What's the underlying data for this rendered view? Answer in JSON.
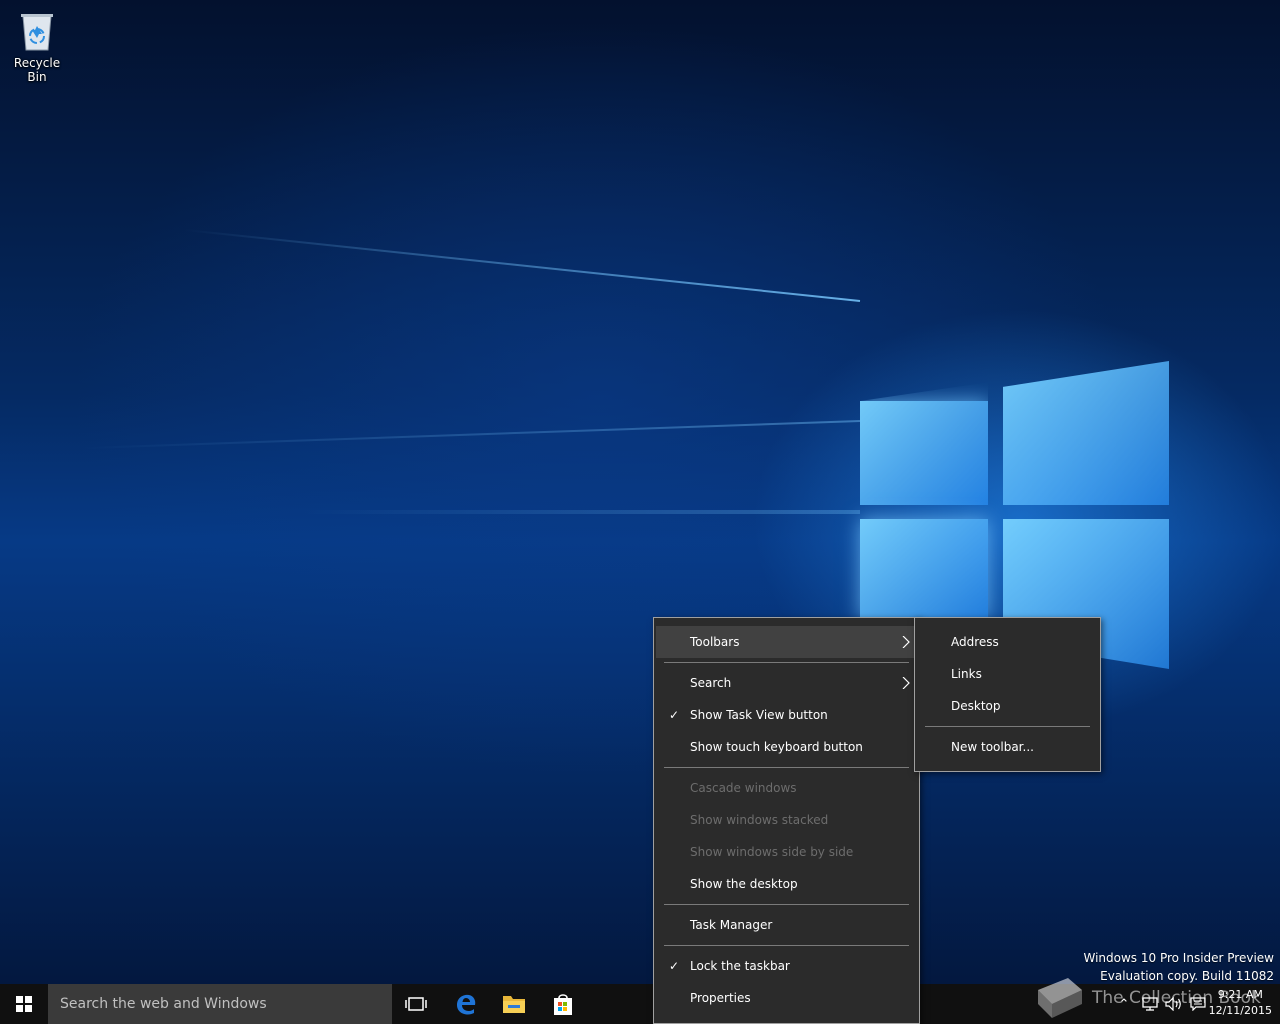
{
  "desktop": {
    "icons": [
      {
        "label": "Recycle Bin",
        "icon": "recycle-bin-icon"
      }
    ]
  },
  "watermark": {
    "line1": "Windows 10 Pro Insider Preview",
    "line2": "Evaluation copy. Build 11082",
    "brand": "The Collection Book"
  },
  "taskbar": {
    "search_placeholder": "Search the web and Windows",
    "pinned": [
      "start-icon",
      "task-view-icon",
      "edge-icon",
      "file-explorer-icon",
      "store-icon"
    ],
    "clock_time": "9:21 AM",
    "clock_date": "12/11/2015"
  },
  "context_menu": {
    "toolbars": "Toolbars",
    "search": "Search",
    "show_task_view": "Show Task View button",
    "show_touch_keyboard": "Show touch keyboard button",
    "cascade": "Cascade windows",
    "stacked": "Show windows stacked",
    "side_by_side": "Show windows side by side",
    "show_desktop": "Show the desktop",
    "task_manager": "Task Manager",
    "lock_taskbar": "Lock the taskbar",
    "properties": "Properties",
    "check_glyph": "✓"
  },
  "toolbars_submenu": {
    "address": "Address",
    "links": "Links",
    "desktop": "Desktop",
    "new_toolbar": "New toolbar..."
  },
  "colors": {
    "taskbar": "#101010",
    "menu_bg": "#2b2b2b",
    "menu_highlight": "#414141",
    "disabled_text": "#6d6d6d",
    "edge_blue": "#1f74d6"
  }
}
